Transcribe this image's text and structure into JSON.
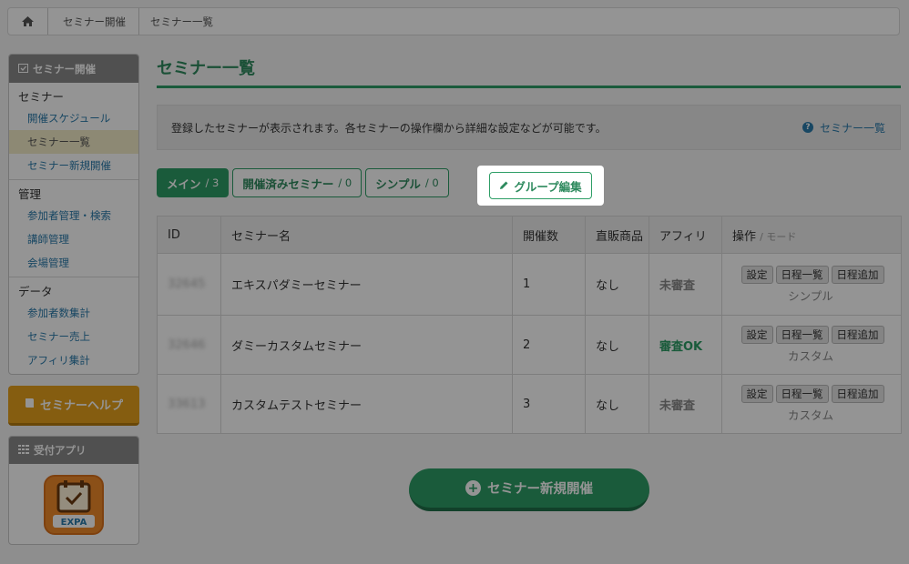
{
  "breadcrumb": {
    "items": [
      "セミナー開催"
    ],
    "current": "セミナー一覧"
  },
  "sidebar": {
    "box_title": "セミナー開催",
    "sections": [
      {
        "title": "セミナー",
        "items": [
          {
            "label": "開催スケジュール"
          },
          {
            "label": "セミナー一覧",
            "active": true
          },
          {
            "label": "セミナー新規開催"
          }
        ]
      },
      {
        "title": "管理",
        "items": [
          {
            "label": "参加者管理・検索"
          },
          {
            "label": "講師管理"
          },
          {
            "label": "会場管理"
          }
        ]
      },
      {
        "title": "データ",
        "items": [
          {
            "label": "参加者数集計"
          },
          {
            "label": "セミナー売上"
          },
          {
            "label": "アフィリ集計"
          }
        ]
      }
    ],
    "help_label": "セミナーヘルプ",
    "app_title": "受付アプリ",
    "app_logo_text": "EXPA"
  },
  "main": {
    "title": "セミナー一覧",
    "info_text": "登録したセミナーが表示されます。各セミナーの操作欄から詳細な設定などが可能です。",
    "info_link": "セミナー一覧",
    "tabs": [
      {
        "label": "メイン",
        "count": "/ 3",
        "active": true
      },
      {
        "label": "開催済みセミナー",
        "count": "/ 0"
      },
      {
        "label": "シンプル",
        "count": "/ 0"
      }
    ],
    "group_edit_label": "グループ編集",
    "table": {
      "headers": {
        "id": "ID",
        "name": "セミナー名",
        "count": "開催数",
        "product": "直販商品",
        "affiliate": "アフィリ",
        "ops": "操作",
        "ops_sub": "/ モード"
      },
      "rows": [
        {
          "id": "32645",
          "name": "エキスパダミーセミナー",
          "count": "1",
          "product": "なし",
          "affiliate": "未審査",
          "affiliate_ok": false,
          "mode": "シンプル"
        },
        {
          "id": "32646",
          "name": "ダミーカスタムセミナー",
          "count": "2",
          "product": "なし",
          "affiliate": "審査OK",
          "affiliate_ok": true,
          "mode": "カスタム"
        },
        {
          "id": "33613",
          "name": "カスタムテストセミナー",
          "count": "3",
          "product": "なし",
          "affiliate": "未審査",
          "affiliate_ok": false,
          "mode": "カスタム"
        }
      ],
      "op_buttons": [
        "設定",
        "日程一覧",
        "日程追加"
      ]
    },
    "new_button": "セミナー新規開催"
  },
  "colors": {
    "accent": "#2e9e66",
    "help": "#e5a01c",
    "link": "#2a7aab"
  }
}
